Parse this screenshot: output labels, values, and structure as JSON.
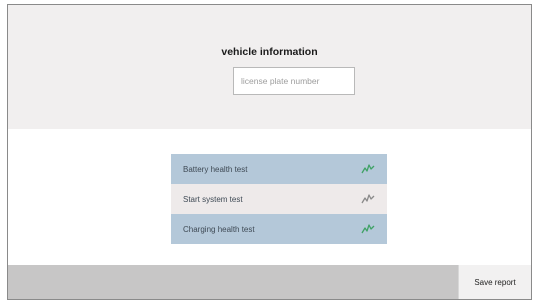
{
  "vehicle_info": {
    "title": "vehicle information",
    "plate_placeholder": "license plate number",
    "plate_value": ""
  },
  "tests": [
    {
      "label": "Battery health test",
      "icon": "health-graph-icon",
      "style": "blue",
      "icon_color": "#3fa266"
    },
    {
      "label": "Start system test",
      "icon": "health-graph-icon",
      "style": "light",
      "icon_color": "#8a8a8a"
    },
    {
      "label": "Charging health test",
      "icon": "health-graph-icon",
      "style": "blue",
      "icon_color": "#3fa266"
    }
  ],
  "footer": {
    "save_label": "Save report"
  },
  "colors": {
    "accent_blue": "#b4c8d9",
    "header_bg": "#f1efef",
    "footer_bg": "#c7c6c6",
    "icon_green": "#3fa266"
  }
}
